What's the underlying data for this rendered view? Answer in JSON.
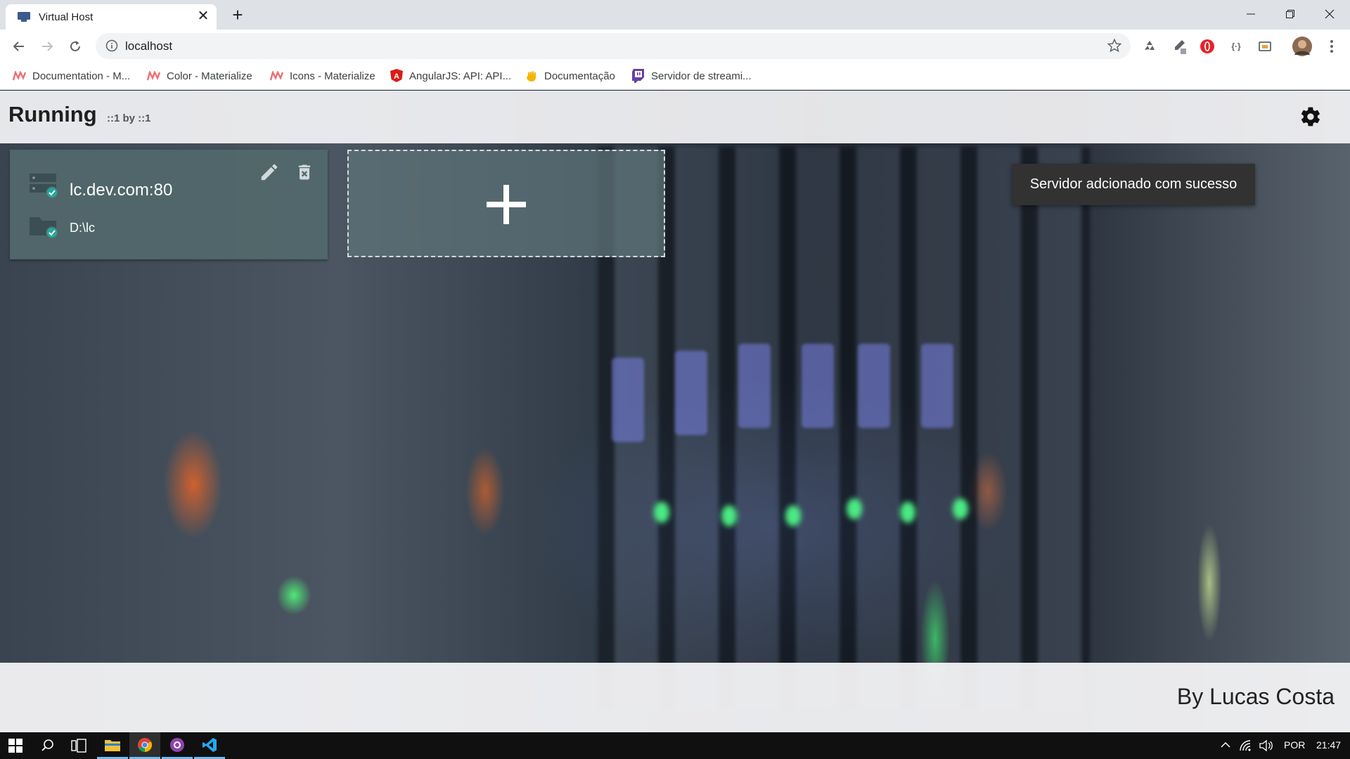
{
  "browser": {
    "tab_title": "Virtual Host",
    "address": "localhost",
    "bookmarks": [
      {
        "label": "Documentation - M...",
        "icon": "materialize-icon"
      },
      {
        "label": "Color - Materialize",
        "icon": "materialize-icon"
      },
      {
        "label": "Icons - Materialize",
        "icon": "materialize-icon"
      },
      {
        "label": "AngularJS: API: API...",
        "icon": "angularjs-icon"
      },
      {
        "label": "Documentação",
        "icon": "hand-icon"
      },
      {
        "label": "Servidor de streami...",
        "icon": "twitch-icon"
      }
    ]
  },
  "app": {
    "title": "Running",
    "subtitle": "::1 by ::1",
    "server": {
      "host": "lc.dev.com:80",
      "path": "D:\\lc"
    },
    "toast": "Servidor adcionado com sucesso",
    "footer": "By Lucas Costa"
  },
  "taskbar": {
    "language": "POR",
    "time": "21:47"
  },
  "colors": {
    "card": "#52686c",
    "toast": "#323232",
    "check": "#2bbbad",
    "taskbar": "#101010"
  }
}
